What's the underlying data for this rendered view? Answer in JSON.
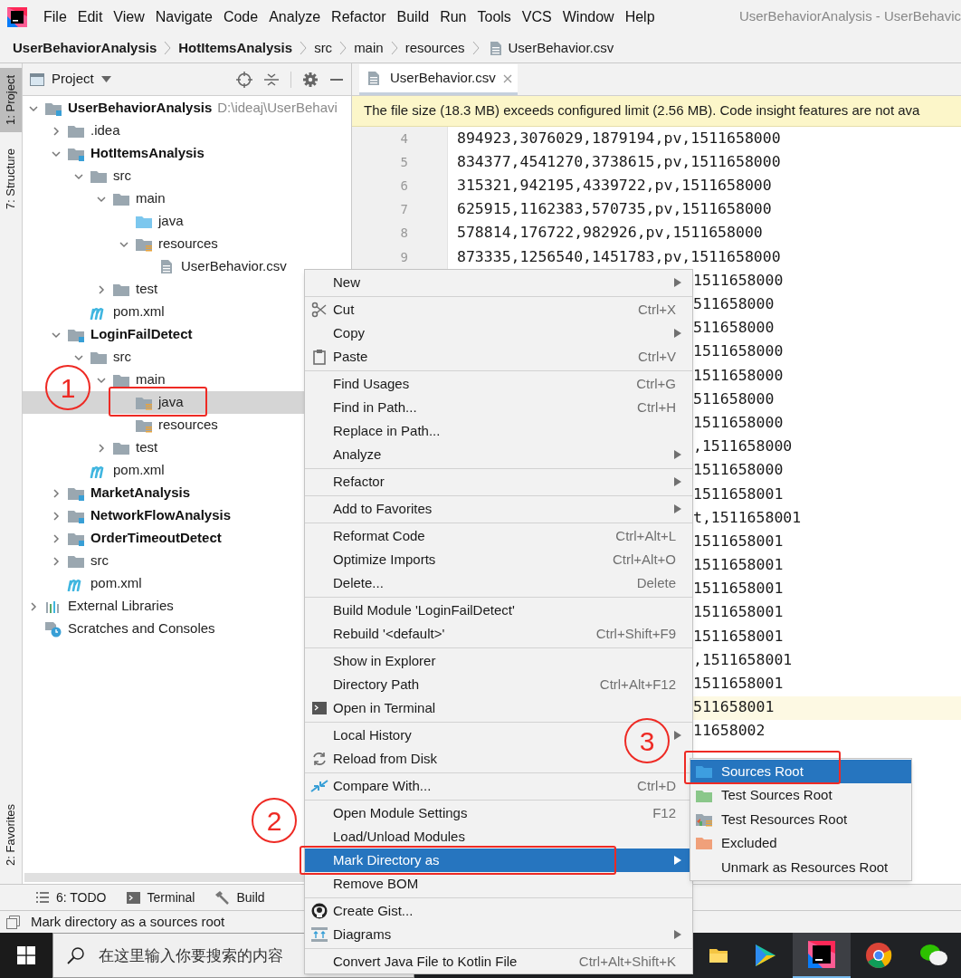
{
  "window_title": "UserBehaviorAnalysis - UserBehavic",
  "menu_bar": [
    "File",
    "Edit",
    "View",
    "Navigate",
    "Code",
    "Analyze",
    "Refactor",
    "Build",
    "Run",
    "Tools",
    "VCS",
    "Window",
    "Help"
  ],
  "breadcrumbs": [
    {
      "label": "UserBehaviorAnalysis",
      "bold": true,
      "kind": "module"
    },
    {
      "label": "HotItemsAnalysis",
      "bold": true,
      "kind": "module"
    },
    {
      "label": "src",
      "bold": false,
      "kind": "folder"
    },
    {
      "label": "main",
      "bold": false,
      "kind": "folder"
    },
    {
      "label": "resources",
      "bold": false,
      "kind": "folder"
    },
    {
      "label": "UserBehavior.csv",
      "bold": false,
      "kind": "file"
    }
  ],
  "tool_strip": {
    "top": [
      {
        "label": "1: Project",
        "selected": true
      },
      {
        "label": "7: Structure",
        "selected": false
      }
    ],
    "bottom": [
      {
        "label": "2: Favorites",
        "selected": false
      }
    ]
  },
  "project_panel": {
    "title": "Project",
    "tree": [
      {
        "label": "UserBehaviorAnalysis",
        "path": "D:\\ideaj\\UserBehavi",
        "kind": "module",
        "bold": true,
        "expanded": true,
        "selected": false,
        "children": [
          {
            "label": ".idea",
            "kind": "folder",
            "bold": false,
            "expanded": false,
            "selected": false
          },
          {
            "label": "HotItemsAnalysis",
            "kind": "module",
            "bold": true,
            "expanded": true,
            "selected": false,
            "children": [
              {
                "label": "src",
                "kind": "folder",
                "bold": false,
                "expanded": true,
                "selected": false,
                "children": [
                  {
                    "label": "main",
                    "kind": "folder",
                    "bold": false,
                    "expanded": true,
                    "selected": false,
                    "children": [
                      {
                        "label": "java",
                        "kind": "source-folder",
                        "bold": false,
                        "selected": false
                      },
                      {
                        "label": "resources",
                        "kind": "resources-folder",
                        "bold": false,
                        "expanded": true,
                        "selected": false,
                        "children": [
                          {
                            "label": "UserBehavior.csv",
                            "kind": "file",
                            "bold": false,
                            "selected": false
                          }
                        ]
                      }
                    ]
                  },
                  {
                    "label": "test",
                    "kind": "folder",
                    "bold": false,
                    "expanded": false,
                    "selected": false
                  }
                ]
              },
              {
                "label": "pom.xml",
                "kind": "maven",
                "bold": false,
                "selected": false
              }
            ]
          },
          {
            "label": "LoginFailDetect",
            "kind": "module",
            "bold": true,
            "expanded": true,
            "selected": false,
            "children": [
              {
                "label": "src",
                "kind": "folder",
                "bold": false,
                "expanded": true,
                "selected": false,
                "children": [
                  {
                    "label": "main",
                    "kind": "folder",
                    "bold": false,
                    "expanded": true,
                    "selected": false,
                    "children": [
                      {
                        "label": "java",
                        "kind": "resources-folder",
                        "bold": false,
                        "selected": true
                      },
                      {
                        "label": "resources",
                        "kind": "resources-folder",
                        "bold": false,
                        "selected": false
                      }
                    ]
                  },
                  {
                    "label": "test",
                    "kind": "folder",
                    "bold": false,
                    "expanded": false,
                    "selected": false
                  }
                ]
              },
              {
                "label": "pom.xml",
                "kind": "maven",
                "bold": false,
                "selected": false
              }
            ]
          },
          {
            "label": "MarketAnalysis",
            "kind": "module",
            "bold": true,
            "expanded": false,
            "selected": false
          },
          {
            "label": "NetworkFlowAnalysis",
            "kind": "module",
            "bold": true,
            "expanded": false,
            "selected": false
          },
          {
            "label": "OrderTimeoutDetect",
            "kind": "module",
            "bold": true,
            "expanded": false,
            "selected": false
          },
          {
            "label": "src",
            "kind": "folder",
            "bold": false,
            "expanded": false,
            "selected": false
          },
          {
            "label": "pom.xml",
            "kind": "maven",
            "bold": false,
            "selected": false
          }
        ]
      },
      {
        "label": "External Libraries",
        "kind": "libraries",
        "bold": false,
        "expanded": false,
        "selected": false
      },
      {
        "label": "Scratches and Consoles",
        "kind": "scratches",
        "bold": false,
        "selected": false
      }
    ]
  },
  "editor": {
    "tab": "UserBehavior.csv",
    "banner": "The file size (18.3 MB) exceeds configured limit (2.56 MB). Code insight features are not ava",
    "lines": [
      {
        "number": "4",
        "text": "894923,3076029,1879194,pv,1511658000",
        "current": false
      },
      {
        "number": "5",
        "text": "834377,4541270,3738615,pv,1511658000",
        "current": false
      },
      {
        "number": "6",
        "text": "315321,942195,4339722,pv,1511658000",
        "current": false
      },
      {
        "number": "7",
        "text": "625915,1162383,570735,pv,1511658000",
        "current": false
      },
      {
        "number": "8",
        "text": "578814,176722,982926,pv,1511658000",
        "current": false
      },
      {
        "number": "9",
        "text": "873335,1256540,1451783,pv,1511658000",
        "current": false
      },
      {
        "text": "1511658000",
        "current": false
      },
      {
        "text": "511658000",
        "current": false
      },
      {
        "text": "511658000",
        "current": false
      },
      {
        "text": "1511658000",
        "current": false
      },
      {
        "text": "1511658000",
        "current": false
      },
      {
        "text": "511658000",
        "current": false
      },
      {
        "text": "1511658000",
        "current": false
      },
      {
        "text": ",1511658000",
        "current": false
      },
      {
        "text": "1511658000",
        "current": false
      },
      {
        "text": "1511658001",
        "current": false
      },
      {
        "text": "t,1511658001",
        "current": false
      },
      {
        "text": "1511658001",
        "current": false
      },
      {
        "text": "1511658001",
        "current": false
      },
      {
        "text": "1511658001",
        "current": false
      },
      {
        "text": "1511658001",
        "current": false
      },
      {
        "text": "1511658001",
        "current": false
      },
      {
        "text": ",1511658001",
        "current": false
      },
      {
        "text": "1511658001",
        "current": false
      },
      {
        "text": "511658001",
        "current": true
      },
      {
        "text": "11658002",
        "current": false
      }
    ]
  },
  "context_menu": [
    [
      {
        "label": "New",
        "submenu": true,
        "selected": false
      }
    ],
    [
      {
        "label": "Cut",
        "shortcut": "Ctrl+X",
        "submenu": false,
        "selected": false
      },
      {
        "label": "Copy",
        "submenu": true,
        "selected": false
      },
      {
        "label": "Paste",
        "shortcut": "Ctrl+V",
        "submenu": false,
        "selected": false
      }
    ],
    [
      {
        "label": "Find Usages",
        "shortcut": "Ctrl+G",
        "submenu": false,
        "selected": false
      },
      {
        "label": "Find in Path...",
        "shortcut": "Ctrl+H",
        "submenu": false,
        "selected": false
      },
      {
        "label": "Replace in Path...",
        "submenu": false,
        "selected": false
      },
      {
        "label": "Analyze",
        "submenu": true,
        "selected": false
      }
    ],
    [
      {
        "label": "Refactor",
        "submenu": true,
        "selected": false
      }
    ],
    [
      {
        "label": "Add to Favorites",
        "submenu": true,
        "selected": false
      }
    ],
    [
      {
        "label": "Reformat Code",
        "shortcut": "Ctrl+Alt+L",
        "submenu": false,
        "selected": false
      },
      {
        "label": "Optimize Imports",
        "shortcut": "Ctrl+Alt+O",
        "submenu": false,
        "selected": false
      },
      {
        "label": "Delete...",
        "shortcut": "Delete",
        "submenu": false,
        "selected": false
      }
    ],
    [
      {
        "label": "Build Module 'LoginFailDetect'",
        "submenu": false,
        "selected": false
      },
      {
        "label": "Rebuild '<default>'",
        "shortcut": "Ctrl+Shift+F9",
        "submenu": false,
        "selected": false
      }
    ],
    [
      {
        "label": "Show in Explorer",
        "submenu": false,
        "selected": false
      },
      {
        "label": "Directory Path",
        "shortcut": "Ctrl+Alt+F12",
        "submenu": false,
        "selected": false
      },
      {
        "label": "Open in Terminal",
        "submenu": false,
        "selected": false
      }
    ],
    [
      {
        "label": "Local History",
        "submenu": true,
        "selected": false
      },
      {
        "label": "Reload from Disk",
        "submenu": false,
        "selected": false
      }
    ],
    [
      {
        "label": "Compare With...",
        "shortcut": "Ctrl+D",
        "submenu": false,
        "selected": false
      }
    ],
    [
      {
        "label": "Open Module Settings",
        "shortcut": "F12",
        "submenu": false,
        "selected": false
      },
      {
        "label": "Load/Unload Modules",
        "submenu": false,
        "selected": false
      },
      {
        "label": "Mark Directory as",
        "submenu": true,
        "selected": true
      },
      {
        "label": "Remove BOM",
        "submenu": false,
        "selected": false
      }
    ],
    [
      {
        "label": "Create Gist...",
        "submenu": false,
        "selected": false
      },
      {
        "label": "Diagrams",
        "submenu": true,
        "selected": false
      }
    ],
    [
      {
        "label": "Convert Java File to Kotlin File",
        "shortcut": "Ctrl+Alt+Shift+K",
        "submenu": false,
        "selected": false
      }
    ]
  ],
  "submenu": [
    {
      "label": "Sources Root",
      "selected": true
    },
    {
      "label": "Test Sources Root",
      "selected": false
    },
    {
      "label": "Test Resources Root",
      "selected": false
    },
    {
      "label": "Excluded",
      "selected": false
    },
    {
      "label": "Unmark as Resources Root",
      "selected": false
    }
  ],
  "bottom_tools": [
    "6: TODO",
    "Terminal",
    "Build"
  ],
  "status_bar": "Mark directory as a sources root",
  "taskbar": {
    "search_placeholder": "在这里输入你要搜索的内容"
  },
  "annotations": [
    "1",
    "2",
    "3"
  ]
}
